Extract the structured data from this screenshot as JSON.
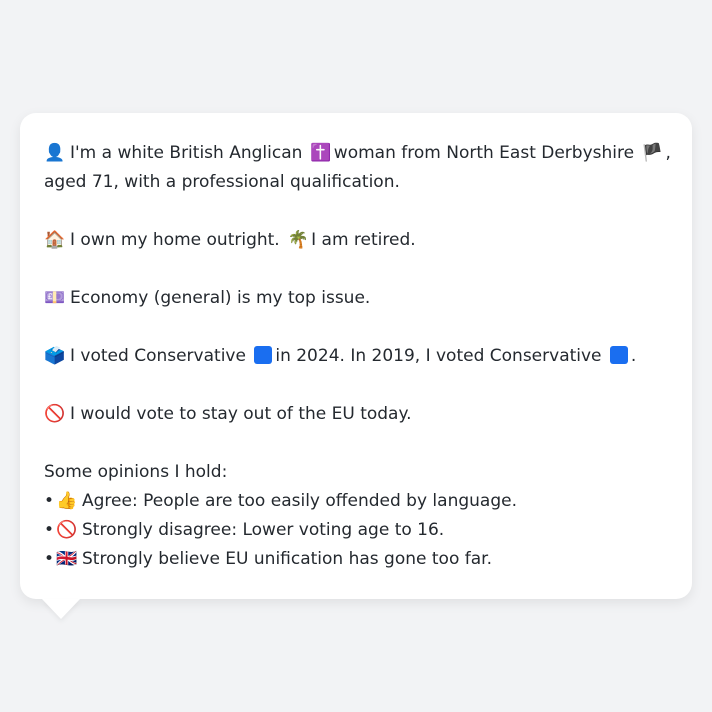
{
  "colors": {
    "background": "#f2f3f5",
    "card": "#ffffff",
    "text": "#24292f",
    "conservative": "#1a6ef0",
    "anglican_icon": "#7a4bc9"
  },
  "profile": {
    "line1": {
      "icon": "person-silhouette-icon",
      "glyph": "👤",
      "text_a": "I'm a white British Anglican",
      "religion_icon": "latin-cross-icon",
      "religion_glyph": "✝️",
      "text_b": "woman from North East Derbyshire",
      "flag_icon": "england-flag-icon",
      "flag_glyph": "🏴",
      "text_c": ",",
      "text_d": "aged 71, with a professional qualification."
    },
    "line2": {
      "icon": "house-icon",
      "glyph": "🏠",
      "text_a": "I own my home outright.",
      "retired_icon": "palm-tree-icon",
      "retired_glyph": "🌴",
      "text_b": "I am retired."
    },
    "line3": {
      "icon": "chart-icon",
      "glyph": "💷",
      "text": "Economy (general) is my top issue."
    },
    "line4": {
      "icon": "ballot-box-icon",
      "glyph": "🗳️",
      "text_a": "I voted Conservative",
      "party_icon": "blue-square-icon",
      "text_b": "in 2024. In 2019, I voted Conservative",
      "text_c": "."
    },
    "line5": {
      "icon": "prohibited-icon",
      "glyph": "🚫",
      "text": "I would vote to stay out of the EU today."
    }
  },
  "opinions": {
    "heading": "Some opinions I hold:",
    "bullet": "•",
    "items": [
      {
        "icon": "thumbs-up-icon",
        "glyph": "👍",
        "text": "Agree: People are too easily offended by language."
      },
      {
        "icon": "prohibited-icon",
        "glyph": "🚫",
        "text": "Strongly disagree: Lower voting age to 16."
      },
      {
        "icon": "uk-flag-icon",
        "glyph": "🇬🇧",
        "text": "Strongly believe EU unification has gone too far."
      }
    ]
  }
}
